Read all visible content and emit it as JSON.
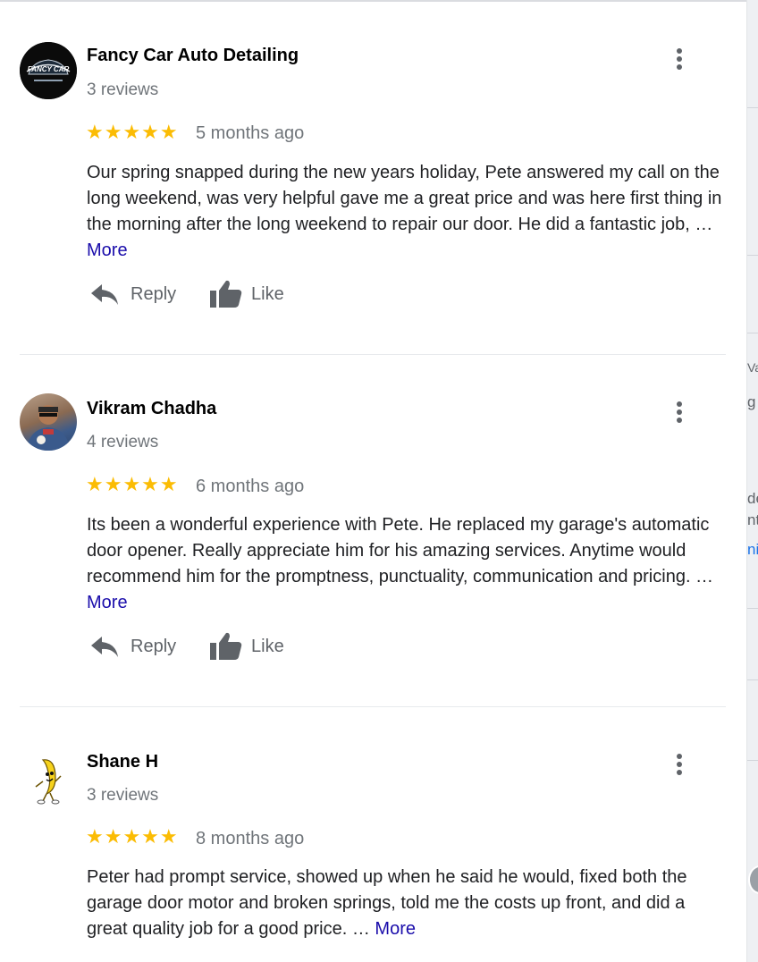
{
  "reviews": [
    {
      "author": "Fancy Car Auto Detailing",
      "review_count": "3 reviews",
      "stars": "★★★★★",
      "rating": 5,
      "age": "5 months ago",
      "text": "Our spring snapped during the new years holiday, Pete answered my call on the long weekend, was very helpful  gave me a great price and was here first thing in the morning after the long weekend to repair our door. He did a fantastic job, …",
      "more_label": "More",
      "avatar_logo_text": "FANCY CAR",
      "reply_label": "Reply",
      "like_label": "Like"
    },
    {
      "author": "Vikram Chadha",
      "review_count": "4 reviews",
      "stars": "★★★★★",
      "rating": 5,
      "age": "6 months ago",
      "text": "Its been a wonderful experience with Pete. He replaced my garage's automatic door opener. Really appreciate him for his amazing services. Anytime would recommend him for the promptness, punctuality, communication and pricing. …",
      "more_label": "More",
      "reply_label": "Reply",
      "like_label": "Like"
    },
    {
      "author": "Shane H",
      "review_count": "3 reviews",
      "stars": "★★★★★",
      "rating": 5,
      "age": "8 months ago",
      "text": "Peter had prompt service, showed up when he said he would, fixed both the garage door motor and broken springs, told me the costs up front, and did a great quality job for a good price. …",
      "more_label": "More"
    }
  ],
  "map_fragments": [
    "Va",
    "g",
    "de",
    "nt",
    "ni"
  ],
  "colors": {
    "star": "#fbbc04",
    "more_link": "#1a0dab",
    "secondary_text": "#70757a",
    "icon": "#5f6368"
  }
}
